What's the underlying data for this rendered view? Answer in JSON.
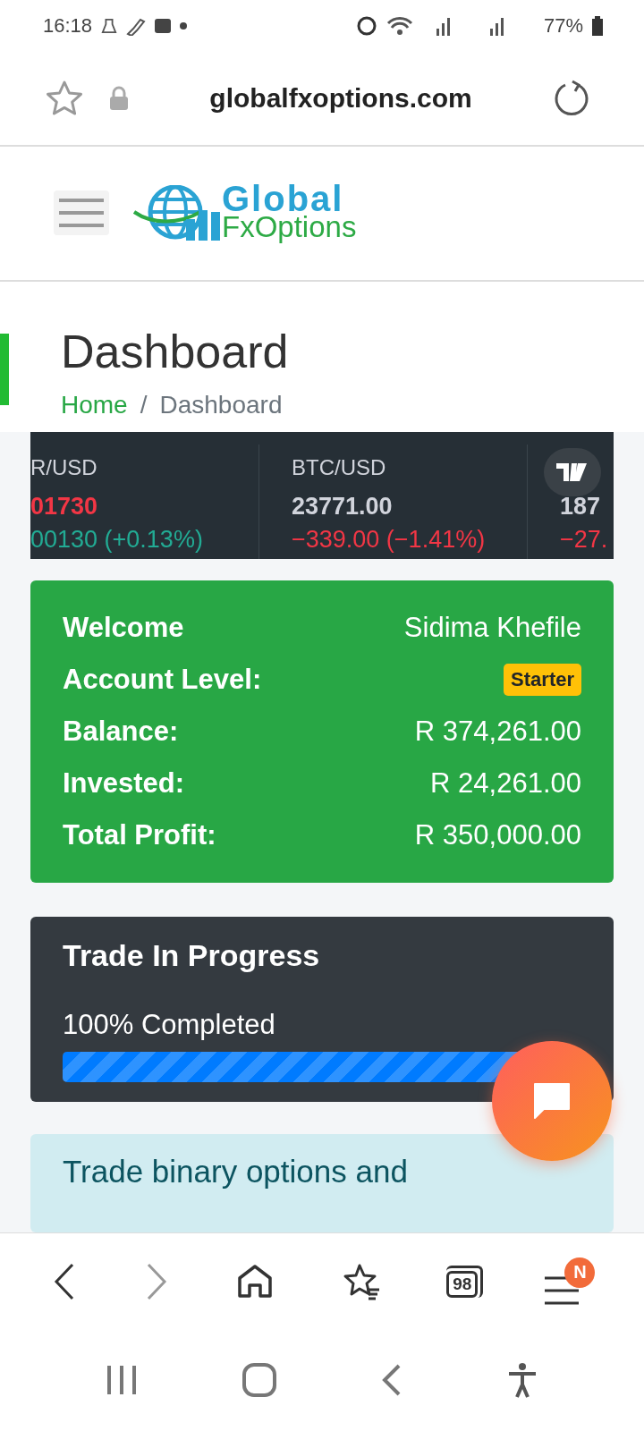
{
  "status_bar": {
    "time": "16:18",
    "battery": "77%"
  },
  "browser": {
    "url": "globalfxoptions.com",
    "tab_count": "98",
    "menu_badge": "N"
  },
  "site_header": {
    "logo_top": "Global",
    "logo_bottom": "FxOptions"
  },
  "page": {
    "title": "Dashboard",
    "breadcrumb": [
      {
        "label": "Home",
        "link": true
      },
      {
        "label": "Dashboard",
        "link": false
      }
    ],
    "breadcrumb_separator": "/"
  },
  "ticker": [
    {
      "symbol": "R/USD",
      "price": {
        "text": "01730",
        "color": "#f23645"
      },
      "change": {
        "text": "00130 (+0.13%)",
        "color": "#22ab94"
      }
    },
    {
      "symbol": "BTC/USD",
      "price": {
        "text": "23771.00",
        "color": "#d1d4dc"
      },
      "change": {
        "text": "−339.00 (−1.41%)",
        "color": "#f23645"
      }
    },
    {
      "price": {
        "text": "187",
        "color": "#d1d4dc"
      },
      "change": {
        "text": "−27.",
        "color": "#f23645"
      }
    }
  ],
  "account_card": {
    "rows": [
      {
        "label": "Welcome",
        "value": "Sidima Khefile",
        "kind": "name"
      },
      {
        "label": "Account Level:",
        "value": "Starter",
        "kind": "badge"
      },
      {
        "label": "Balance:",
        "value": "R 374,261.00",
        "kind": "amount"
      },
      {
        "label": "Invested:",
        "value": "R 24,261.00",
        "kind": "amount"
      },
      {
        "label": "Total Profit:",
        "value": "R 350,000.00",
        "kind": "amount"
      }
    ]
  },
  "trade_card": {
    "title": "Trade In Progress",
    "progress_label": "100% Completed",
    "level": 1
  },
  "info_card": {
    "text": "Trade binary options and"
  }
}
